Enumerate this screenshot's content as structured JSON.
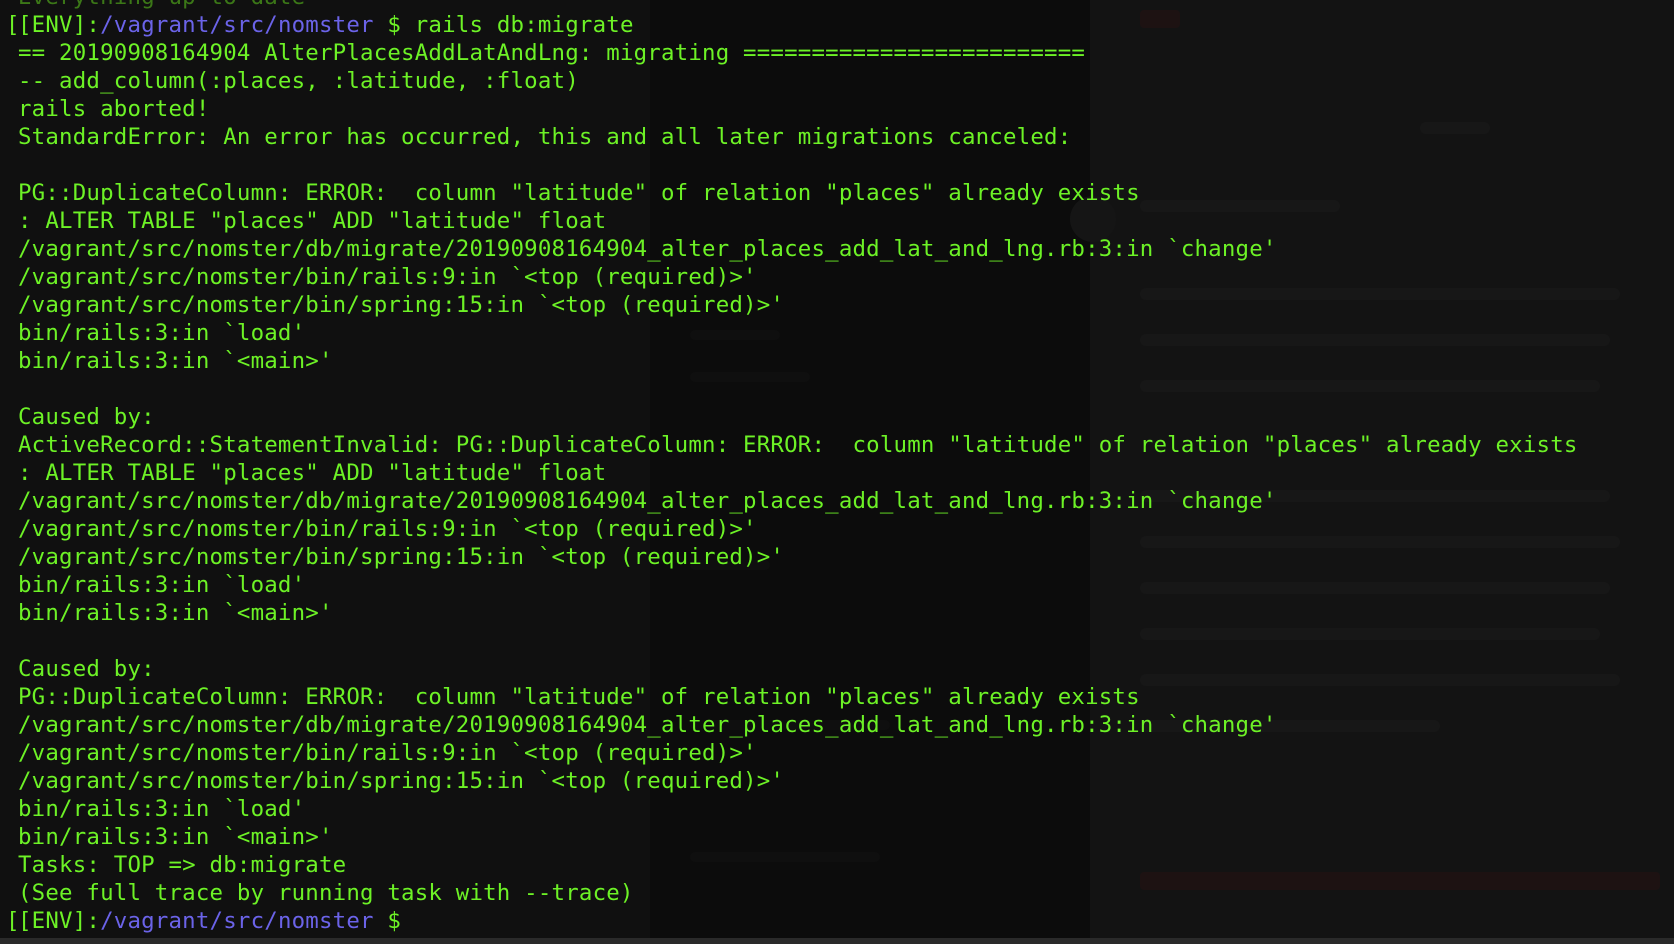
{
  "colors": {
    "terminal_text": "#6df226",
    "path_text": "#6b63e8",
    "background": "#0e0e0e"
  },
  "lines": [
    {
      "segments": [
        {
          "type": "faded",
          "text": "Everything up-to-date"
        }
      ]
    },
    {
      "segments": [
        {
          "type": "env",
          "text": "[ENV]:"
        },
        {
          "type": "path",
          "text": "/vagrant/src/nomster"
        },
        {
          "type": "prompt",
          "text": " $ "
        },
        {
          "type": "cmd",
          "text": "rails db:migrate"
        }
      ]
    },
    {
      "segments": [
        {
          "type": "plain",
          "text": "== 20190908164904 AlterPlacesAddLatAndLng: migrating ========================="
        }
      ]
    },
    {
      "segments": [
        {
          "type": "plain",
          "text": "-- add_column(:places, :latitude, :float)"
        }
      ]
    },
    {
      "segments": [
        {
          "type": "plain",
          "text": "rails aborted!"
        }
      ]
    },
    {
      "segments": [
        {
          "type": "plain",
          "text": "StandardError: An error has occurred, this and all later migrations canceled:"
        }
      ]
    },
    {
      "segments": [
        {
          "type": "plain",
          "text": ""
        }
      ]
    },
    {
      "segments": [
        {
          "type": "plain",
          "text": "PG::DuplicateColumn: ERROR:  column \"latitude\" of relation \"places\" already exists"
        }
      ]
    },
    {
      "segments": [
        {
          "type": "plain",
          "text": ": ALTER TABLE \"places\" ADD \"latitude\" float"
        }
      ]
    },
    {
      "segments": [
        {
          "type": "plain",
          "text": "/vagrant/src/nomster/db/migrate/20190908164904_alter_places_add_lat_and_lng.rb:3:in `change'"
        }
      ]
    },
    {
      "segments": [
        {
          "type": "plain",
          "text": "/vagrant/src/nomster/bin/rails:9:in `<top (required)>'"
        }
      ]
    },
    {
      "segments": [
        {
          "type": "plain",
          "text": "/vagrant/src/nomster/bin/spring:15:in `<top (required)>'"
        }
      ]
    },
    {
      "segments": [
        {
          "type": "plain",
          "text": "bin/rails:3:in `load'"
        }
      ]
    },
    {
      "segments": [
        {
          "type": "plain",
          "text": "bin/rails:3:in `<main>'"
        }
      ]
    },
    {
      "segments": [
        {
          "type": "plain",
          "text": ""
        }
      ]
    },
    {
      "segments": [
        {
          "type": "plain",
          "text": "Caused by:"
        }
      ]
    },
    {
      "segments": [
        {
          "type": "plain",
          "text": "ActiveRecord::StatementInvalid: PG::DuplicateColumn: ERROR:  column \"latitude\" of relation \"places\" already exists"
        }
      ]
    },
    {
      "segments": [
        {
          "type": "plain",
          "text": ": ALTER TABLE \"places\" ADD \"latitude\" float"
        }
      ]
    },
    {
      "segments": [
        {
          "type": "plain",
          "text": "/vagrant/src/nomster/db/migrate/20190908164904_alter_places_add_lat_and_lng.rb:3:in `change'"
        }
      ]
    },
    {
      "segments": [
        {
          "type": "plain",
          "text": "/vagrant/src/nomster/bin/rails:9:in `<top (required)>'"
        }
      ]
    },
    {
      "segments": [
        {
          "type": "plain",
          "text": "/vagrant/src/nomster/bin/spring:15:in `<top (required)>'"
        }
      ]
    },
    {
      "segments": [
        {
          "type": "plain",
          "text": "bin/rails:3:in `load'"
        }
      ]
    },
    {
      "segments": [
        {
          "type": "plain",
          "text": "bin/rails:3:in `<main>'"
        }
      ]
    },
    {
      "segments": [
        {
          "type": "plain",
          "text": ""
        }
      ]
    },
    {
      "segments": [
        {
          "type": "plain",
          "text": "Caused by:"
        }
      ]
    },
    {
      "segments": [
        {
          "type": "plain",
          "text": "PG::DuplicateColumn: ERROR:  column \"latitude\" of relation \"places\" already exists"
        }
      ]
    },
    {
      "segments": [
        {
          "type": "plain",
          "text": "/vagrant/src/nomster/db/migrate/20190908164904_alter_places_add_lat_and_lng.rb:3:in `change'"
        }
      ]
    },
    {
      "segments": [
        {
          "type": "plain",
          "text": "/vagrant/src/nomster/bin/rails:9:in `<top (required)>'"
        }
      ]
    },
    {
      "segments": [
        {
          "type": "plain",
          "text": "/vagrant/src/nomster/bin/spring:15:in `<top (required)>'"
        }
      ]
    },
    {
      "segments": [
        {
          "type": "plain",
          "text": "bin/rails:3:in `load'"
        }
      ]
    },
    {
      "segments": [
        {
          "type": "plain",
          "text": "bin/rails:3:in `<main>'"
        }
      ]
    },
    {
      "segments": [
        {
          "type": "plain",
          "text": "Tasks: TOP => db:migrate"
        }
      ]
    },
    {
      "segments": [
        {
          "type": "plain",
          "text": "(See full trace by running task with --trace)"
        }
      ]
    },
    {
      "segments": [
        {
          "type": "env",
          "text": "[ENV]:"
        },
        {
          "type": "path",
          "text": "/vagrant/src/nomster"
        },
        {
          "type": "prompt",
          "text": " $ "
        }
      ]
    }
  ]
}
